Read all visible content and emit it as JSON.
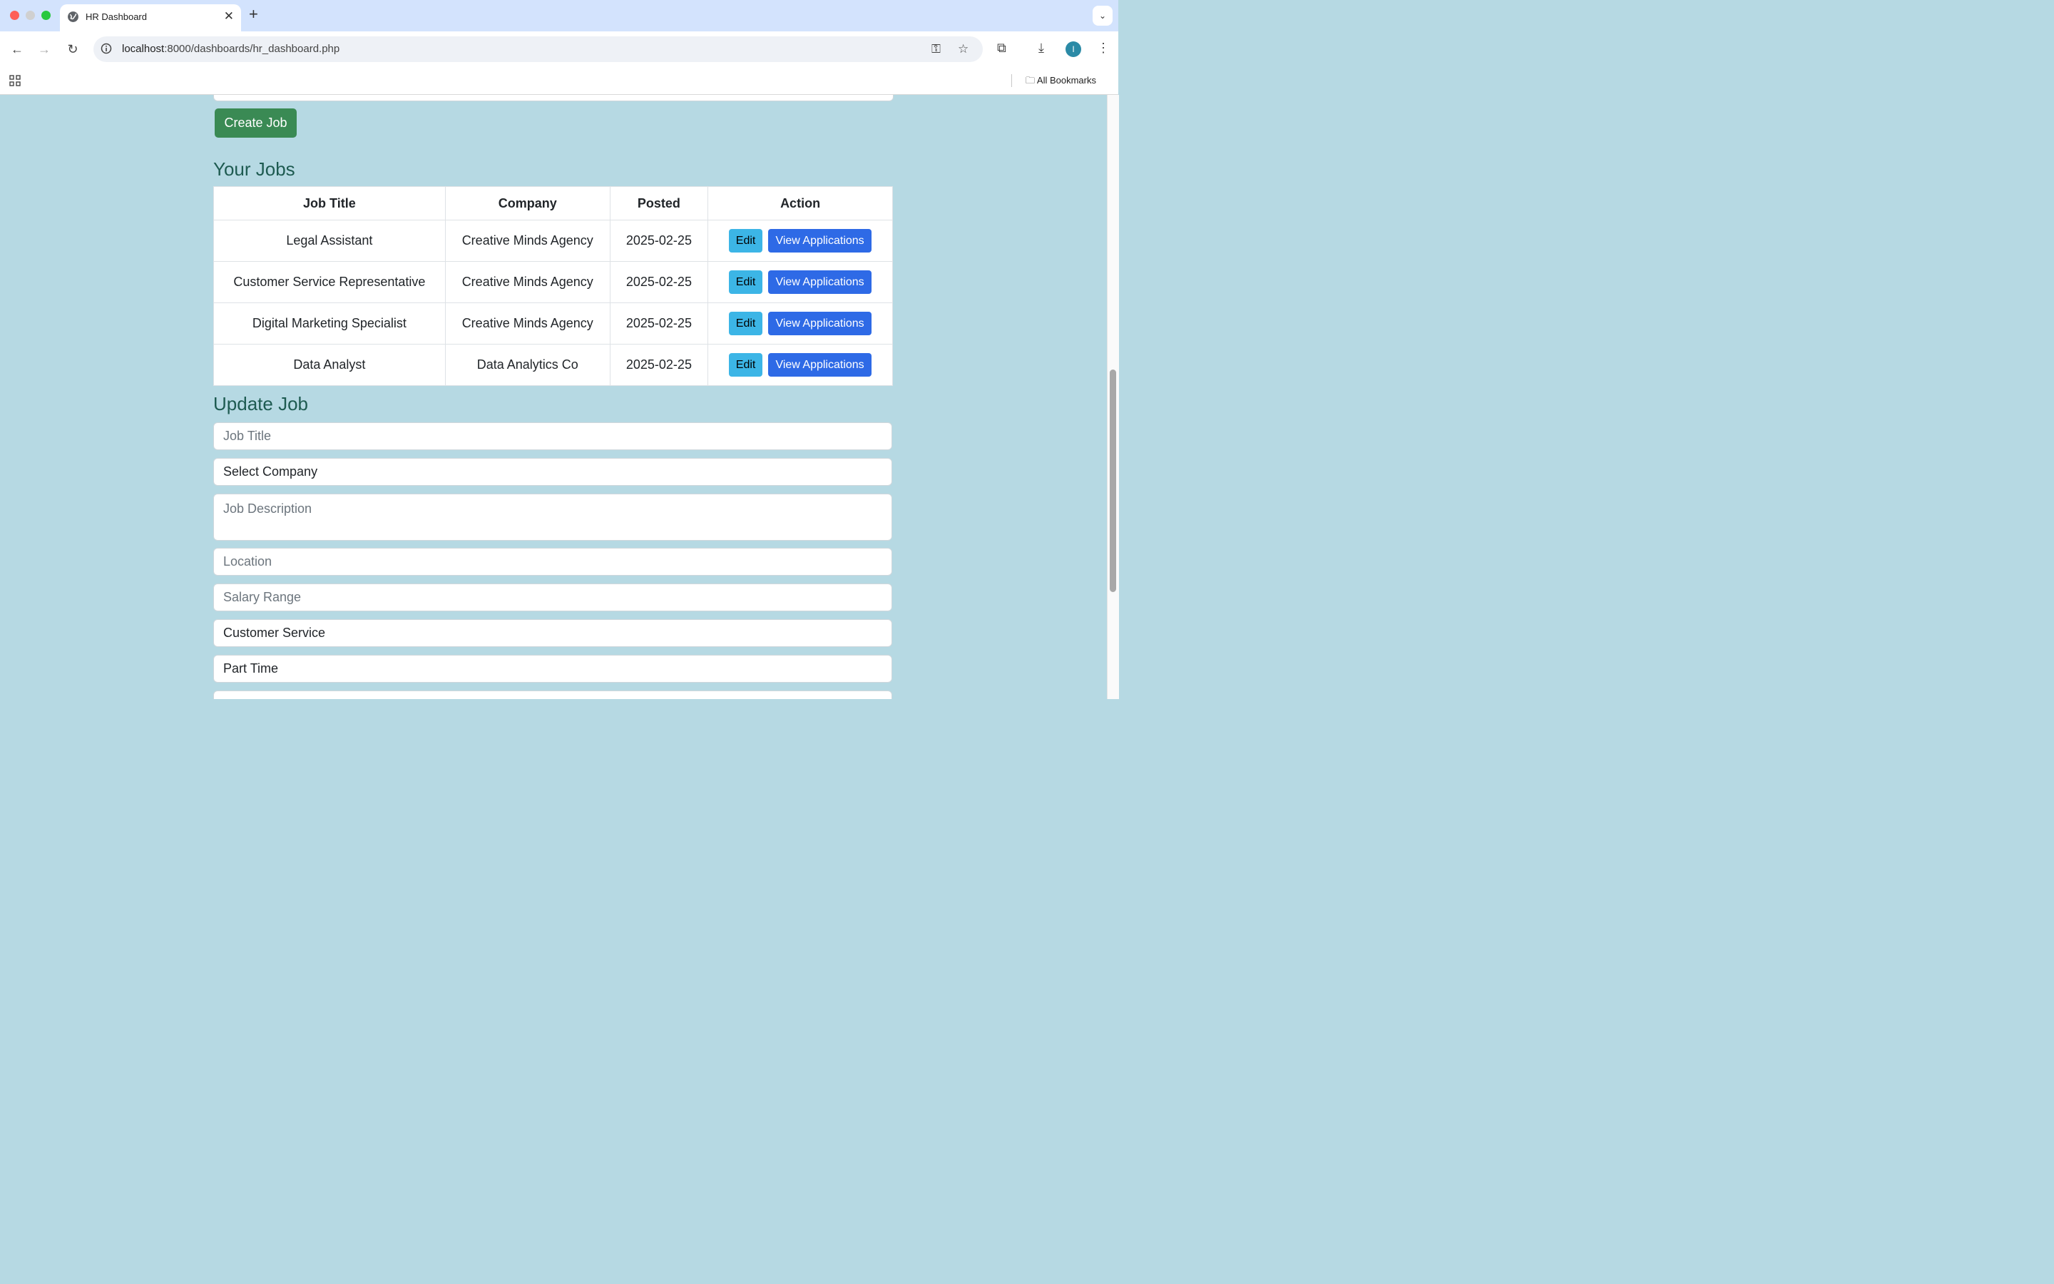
{
  "browser": {
    "tab_title": "HR Dashboard",
    "url_domain": "localhost",
    "url_path": ":8000/dashboards/hr_dashboard.php",
    "bookmarks_label": "All Bookmarks",
    "avatar_letter": "I"
  },
  "page": {
    "create_button": "Create Job",
    "jobs_heading": "Your Jobs",
    "table_headers": [
      "Job Title",
      "Company",
      "Posted",
      "Action"
    ],
    "jobs": [
      {
        "title": "Legal Assistant",
        "company": "Creative Minds Agency",
        "posted": "2025-02-25"
      },
      {
        "title": "Customer Service Representative",
        "company": "Creative Minds Agency",
        "posted": "2025-02-25"
      },
      {
        "title": "Digital Marketing Specialist",
        "company": "Creative Minds Agency",
        "posted": "2025-02-25"
      },
      {
        "title": "Data Analyst",
        "company": "Data Analytics Co",
        "posted": "2025-02-25"
      }
    ],
    "edit_label": "Edit",
    "view_label": "View Applications",
    "update_heading": "Update Job",
    "form": {
      "job_title_placeholder": "Job Title",
      "company_select": "Select Company",
      "description_placeholder": "Job Description",
      "location_placeholder": "Location",
      "salary_placeholder": "Salary Range",
      "category_select": "Customer Service",
      "type_select": "Part Time"
    }
  }
}
